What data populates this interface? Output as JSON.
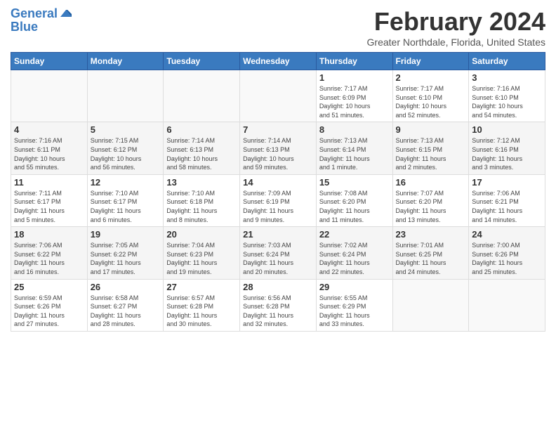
{
  "header": {
    "logo_line1": "General",
    "logo_line2": "Blue",
    "title": "February 2024",
    "subtitle": "Greater Northdale, Florida, United States"
  },
  "days_of_week": [
    "Sunday",
    "Monday",
    "Tuesday",
    "Wednesday",
    "Thursday",
    "Friday",
    "Saturday"
  ],
  "weeks": [
    [
      {
        "num": "",
        "info": ""
      },
      {
        "num": "",
        "info": ""
      },
      {
        "num": "",
        "info": ""
      },
      {
        "num": "",
        "info": ""
      },
      {
        "num": "1",
        "info": "Sunrise: 7:17 AM\nSunset: 6:09 PM\nDaylight: 10 hours\nand 51 minutes."
      },
      {
        "num": "2",
        "info": "Sunrise: 7:17 AM\nSunset: 6:10 PM\nDaylight: 10 hours\nand 52 minutes."
      },
      {
        "num": "3",
        "info": "Sunrise: 7:16 AM\nSunset: 6:10 PM\nDaylight: 10 hours\nand 54 minutes."
      }
    ],
    [
      {
        "num": "4",
        "info": "Sunrise: 7:16 AM\nSunset: 6:11 PM\nDaylight: 10 hours\nand 55 minutes."
      },
      {
        "num": "5",
        "info": "Sunrise: 7:15 AM\nSunset: 6:12 PM\nDaylight: 10 hours\nand 56 minutes."
      },
      {
        "num": "6",
        "info": "Sunrise: 7:14 AM\nSunset: 6:13 PM\nDaylight: 10 hours\nand 58 minutes."
      },
      {
        "num": "7",
        "info": "Sunrise: 7:14 AM\nSunset: 6:13 PM\nDaylight: 10 hours\nand 59 minutes."
      },
      {
        "num": "8",
        "info": "Sunrise: 7:13 AM\nSunset: 6:14 PM\nDaylight: 11 hours\nand 1 minute."
      },
      {
        "num": "9",
        "info": "Sunrise: 7:13 AM\nSunset: 6:15 PM\nDaylight: 11 hours\nand 2 minutes."
      },
      {
        "num": "10",
        "info": "Sunrise: 7:12 AM\nSunset: 6:16 PM\nDaylight: 11 hours\nand 3 minutes."
      }
    ],
    [
      {
        "num": "11",
        "info": "Sunrise: 7:11 AM\nSunset: 6:17 PM\nDaylight: 11 hours\nand 5 minutes."
      },
      {
        "num": "12",
        "info": "Sunrise: 7:10 AM\nSunset: 6:17 PM\nDaylight: 11 hours\nand 6 minutes."
      },
      {
        "num": "13",
        "info": "Sunrise: 7:10 AM\nSunset: 6:18 PM\nDaylight: 11 hours\nand 8 minutes."
      },
      {
        "num": "14",
        "info": "Sunrise: 7:09 AM\nSunset: 6:19 PM\nDaylight: 11 hours\nand 9 minutes."
      },
      {
        "num": "15",
        "info": "Sunrise: 7:08 AM\nSunset: 6:20 PM\nDaylight: 11 hours\nand 11 minutes."
      },
      {
        "num": "16",
        "info": "Sunrise: 7:07 AM\nSunset: 6:20 PM\nDaylight: 11 hours\nand 13 minutes."
      },
      {
        "num": "17",
        "info": "Sunrise: 7:06 AM\nSunset: 6:21 PM\nDaylight: 11 hours\nand 14 minutes."
      }
    ],
    [
      {
        "num": "18",
        "info": "Sunrise: 7:06 AM\nSunset: 6:22 PM\nDaylight: 11 hours\nand 16 minutes."
      },
      {
        "num": "19",
        "info": "Sunrise: 7:05 AM\nSunset: 6:22 PM\nDaylight: 11 hours\nand 17 minutes."
      },
      {
        "num": "20",
        "info": "Sunrise: 7:04 AM\nSunset: 6:23 PM\nDaylight: 11 hours\nand 19 minutes."
      },
      {
        "num": "21",
        "info": "Sunrise: 7:03 AM\nSunset: 6:24 PM\nDaylight: 11 hours\nand 20 minutes."
      },
      {
        "num": "22",
        "info": "Sunrise: 7:02 AM\nSunset: 6:24 PM\nDaylight: 11 hours\nand 22 minutes."
      },
      {
        "num": "23",
        "info": "Sunrise: 7:01 AM\nSunset: 6:25 PM\nDaylight: 11 hours\nand 24 minutes."
      },
      {
        "num": "24",
        "info": "Sunrise: 7:00 AM\nSunset: 6:26 PM\nDaylight: 11 hours\nand 25 minutes."
      }
    ],
    [
      {
        "num": "25",
        "info": "Sunrise: 6:59 AM\nSunset: 6:26 PM\nDaylight: 11 hours\nand 27 minutes."
      },
      {
        "num": "26",
        "info": "Sunrise: 6:58 AM\nSunset: 6:27 PM\nDaylight: 11 hours\nand 28 minutes."
      },
      {
        "num": "27",
        "info": "Sunrise: 6:57 AM\nSunset: 6:28 PM\nDaylight: 11 hours\nand 30 minutes."
      },
      {
        "num": "28",
        "info": "Sunrise: 6:56 AM\nSunset: 6:28 PM\nDaylight: 11 hours\nand 32 minutes."
      },
      {
        "num": "29",
        "info": "Sunrise: 6:55 AM\nSunset: 6:29 PM\nDaylight: 11 hours\nand 33 minutes."
      },
      {
        "num": "",
        "info": ""
      },
      {
        "num": "",
        "info": ""
      }
    ]
  ]
}
